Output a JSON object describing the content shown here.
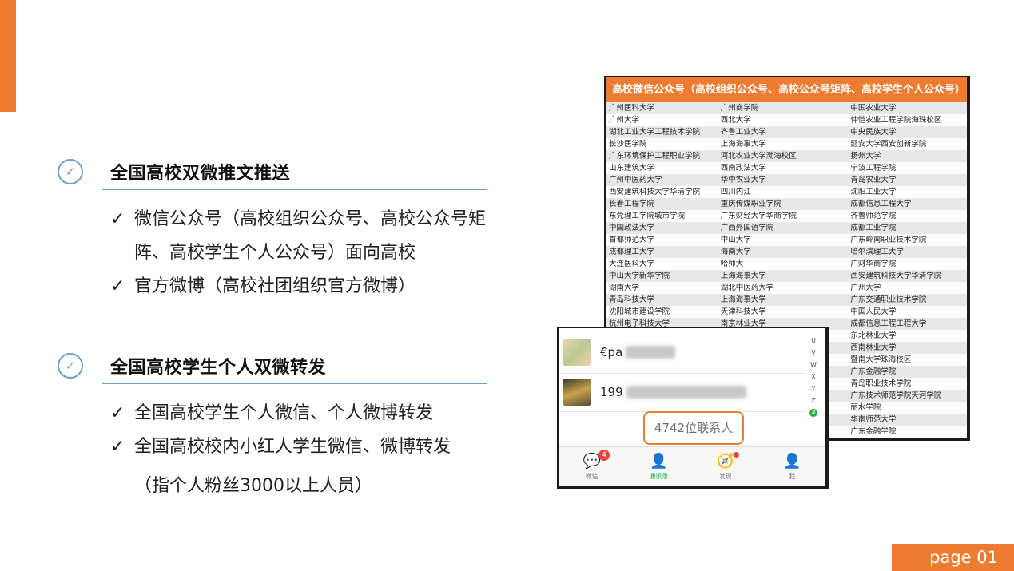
{
  "sections": [
    {
      "icon": "check-circle-icon",
      "title": "全国高校双微推文推送",
      "bullets": [
        "微信公众号（高校组织公众号、高校公众号矩阵、高校学生个人公众号）面向高校",
        "官方微博（高校社团组织官方微博）"
      ]
    },
    {
      "icon": "check-circle-icon",
      "title": "全国高校学生个人双微转发",
      "bullets": [
        "全国高校学生个人微信、个人微博转发",
        "全国高校校内小红人学生微信、微博转发"
      ],
      "note": "（指个人粉丝3000以上人员）"
    }
  ],
  "table": {
    "header": "高校微信公众号（高校组织公众号、高校公众号矩阵、高校学生个人公众号）",
    "rows": [
      [
        "广州医科大学",
        "广州商学院",
        "中国农业大学"
      ],
      [
        "广州大学",
        "西北大学",
        "仲恺农业工程学院海珠校区"
      ],
      [
        "湖北工业大学工程技术学院",
        "齐鲁工业大学",
        "中央民族大学"
      ],
      [
        "长沙医学院",
        "上海海事大学",
        "延安大学西安创新学院"
      ],
      [
        "广东环境保护工程职业学院",
        "河北农业大学渤海校区",
        "扬州大学"
      ],
      [
        "山东建筑大学",
        "西南政法大学",
        "宁波工程学院"
      ],
      [
        "广州中医药大学",
        "华中农业大学",
        "青岛农业大学"
      ],
      [
        "西安建筑科技大学华清学院",
        "四川内江",
        "沈阳工业大学"
      ],
      [
        "长春工程学院",
        "重庆传媒职业学院",
        "成都信息工程大学"
      ],
      [
        "东莞理工学院城市学院",
        "广东财经大学华商学院",
        "齐鲁师范学院"
      ],
      [
        "中国政法大学",
        "广西外国语学院",
        "成都工业学院"
      ],
      [
        "首都师范大学",
        "中山大学",
        "广东岭南职业技术学院"
      ],
      [
        "成都理工大学",
        "海南大学",
        "哈尔滨理工大学"
      ],
      [
        "大连医科大学",
        "哈师大",
        "广财华商学院"
      ],
      [
        "中山大学新华学院",
        "上海海事大学",
        "西安建筑科技大学华清学院"
      ],
      [
        "湖南大学",
        "湖北中医药大学",
        "广州大学"
      ],
      [
        "青岛科技大学",
        "上海海事大学",
        "广东交通职业技术学院"
      ],
      [
        "沈阳城市建设学院",
        "天津科技大学",
        "中国人民大学"
      ],
      [
        "杭州电子科技大学",
        "南京林业大学",
        "成都信息工程工程大学"
      ],
      [
        "",
        "",
        "东北林业大学"
      ],
      [
        "",
        "",
        "西南林业大学"
      ],
      [
        "",
        "",
        "暨南大学珠海校区"
      ],
      [
        "",
        "",
        "广东金融学院"
      ],
      [
        "",
        "",
        "青岛职业技术学院"
      ],
      [
        "",
        "",
        "广东技术师范学院天河学院"
      ],
      [
        "",
        "",
        "丽水学院"
      ],
      [
        "",
        "",
        "华南师范大学"
      ],
      [
        "",
        "",
        "广东金融学院"
      ]
    ]
  },
  "phone": {
    "contacts": [
      {
        "name": "€pa"
      },
      {
        "name": "199"
      }
    ],
    "index_letters": [
      "U",
      "V",
      "W",
      "X",
      "Y",
      "Z",
      "#"
    ],
    "contact_count": "4742位联系人",
    "tabs": [
      {
        "label": "微信",
        "icon": "chat-bubble-icon",
        "badge": "4"
      },
      {
        "label": "通讯录",
        "icon": "contacts-icon",
        "active": true
      },
      {
        "label": "发现",
        "icon": "compass-icon"
      },
      {
        "label": "我",
        "icon": "person-icon"
      }
    ]
  },
  "page_label": "page 01",
  "colors": {
    "accent": "#ee7c30",
    "check_blue": "#6f9fcd",
    "wechat_green": "#27a93c"
  }
}
